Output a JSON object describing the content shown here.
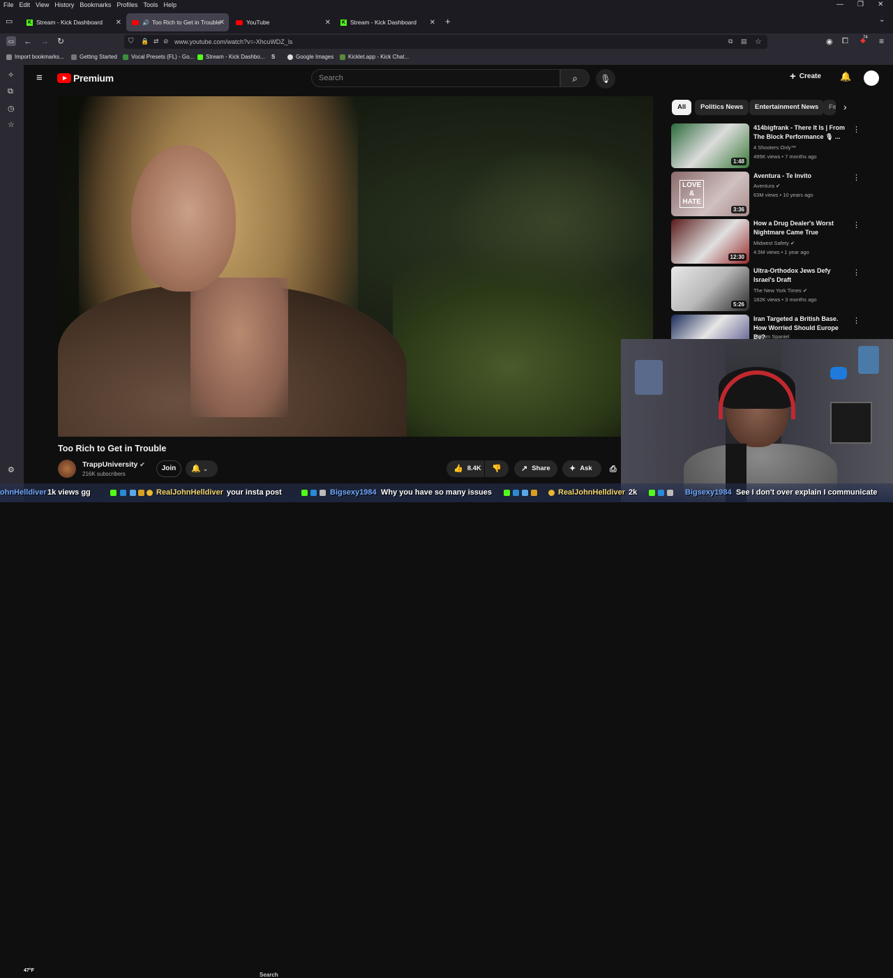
{
  "menubar": {
    "items": [
      "File",
      "Edit",
      "View",
      "History",
      "Bookmarks",
      "Profiles",
      "Tools",
      "Help"
    ]
  },
  "tabs": [
    {
      "label": "Stream - Kick Dashboard",
      "icon": "kick-icon",
      "active": false
    },
    {
      "label": "Too Rich to Get in Trouble",
      "icon": "youtube-icon",
      "active": true
    },
    {
      "label": "YouTube",
      "icon": "youtube-icon",
      "active": false
    },
    {
      "label": "Stream - Kick Dashboard",
      "icon": "kick-icon",
      "active": false
    }
  ],
  "navbar": {
    "url": "www.youtube.com/watch?v=-XhcuWDZ_ls",
    "badge": "74"
  },
  "bookmarks": [
    "Import bookmarks...",
    "Getting Started",
    "Vocal Presets (FL) - Go...",
    "Stream - Kick Dashbo...",
    "S",
    "Google Images",
    "Kicklet.app - Kick Chat..."
  ],
  "youtube": {
    "brand": "Premium",
    "search_placeholder": "Search",
    "create_label": "Create",
    "video": {
      "title": "Too Rich to Get in Trouble",
      "channel": "TrappUniversity",
      "subscribers": "216K subscribers",
      "join_label": "Join",
      "likes": "8.4K",
      "share_label": "Share",
      "ask_label": "Ask"
    },
    "chips": [
      "All",
      "Politics News",
      "Entertainment News",
      "Fe"
    ],
    "recommendations": [
      {
        "title": "414bigfrank - There It Is | From The Block Performance 🎙 ...",
        "channel": "4 Shooters Only™",
        "meta": "495K views • 7 months ago",
        "duration": "1:48",
        "thumb_color": "#3f7a3a"
      },
      {
        "title": "Aventura - Te Invito",
        "channel": "Aventura",
        "meta": "63M views • 10 years ago",
        "duration": "3:36",
        "thumb_color": "#a88a8a",
        "thumb_text": [
          "LOVE",
          "&",
          "HATE"
        ]
      },
      {
        "title": "How a Drug Dealer's Worst Nightmare Came True",
        "channel": "Midwest Safety",
        "meta": "4.5M views • 1 year ago",
        "duration": "12:30",
        "thumb_color": "#8a2a2a"
      },
      {
        "title": "Ultra-Orthodox Jews Defy Israel's Draft",
        "channel": "The New York Times",
        "meta": "182K views • 3 months ago",
        "duration": "5:26",
        "thumb_color": "#cfcfcf"
      },
      {
        "title": "Iran Targeted a British Base. How Worried Should Europe Be?",
        "channel": "William Spaniel",
        "meta": "",
        "duration": "",
        "thumb_color": "#2a3a6a"
      }
    ]
  },
  "taskbar": {
    "temperature": "47°F",
    "search": "Search"
  },
  "chat": [
    {
      "name": "ohnHelldiver",
      "msg": "1k views gg"
    },
    {
      "name": "RealJohnHelldiver",
      "msg": "your insta post"
    },
    {
      "name": "Bigsexy1984",
      "msg": "Why you have so many issues"
    },
    {
      "name": "RealJohnHelldiver",
      "msg": "2k"
    },
    {
      "name": "Bigsexy1984",
      "msg": "See I don't over explain I communicate"
    }
  ],
  "colors": {
    "accent_red": "#ff0000",
    "kick_green": "#53fc18",
    "chat_name": "#f5d76e",
    "chat_name_alt": "#6fa8ff"
  }
}
